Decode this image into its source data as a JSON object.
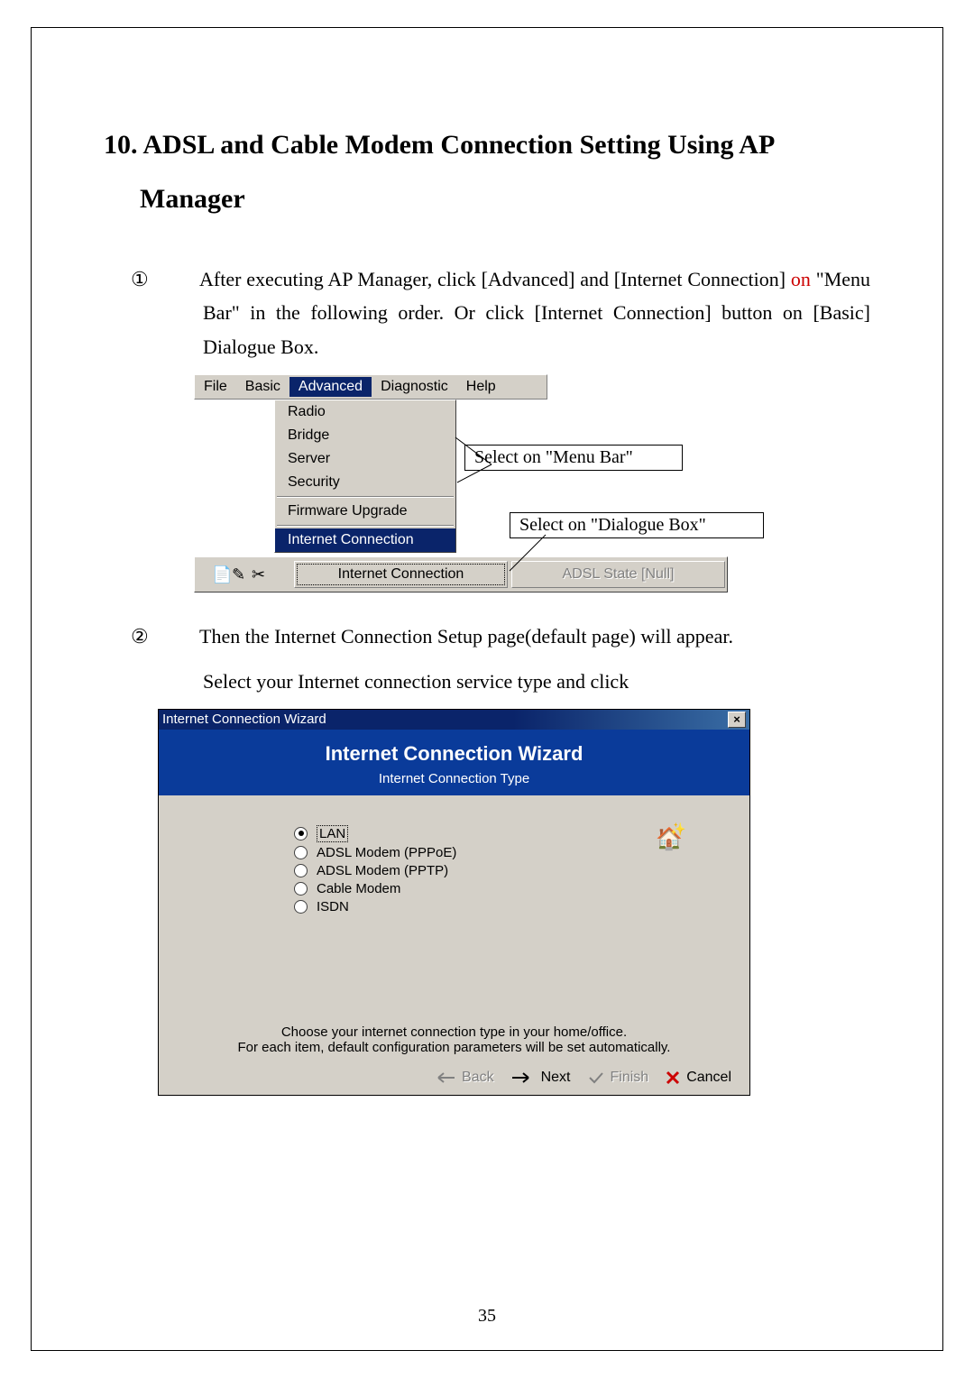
{
  "section": {
    "number": "10.",
    "title": "ADSL and Cable Modem Connection Setting Using AP Manager"
  },
  "step1": {
    "marker": "①",
    "pre": "After executing AP Manager, click [Advanced] and [Internet Connection]",
    "red": " on",
    "post": " \"Menu Bar\" in the following order. Or click [Internet Connection] button on [Basic] Dialogue Box."
  },
  "step2": {
    "marker": "②",
    "line1": "Then the Internet Connection Setup page(default page) will appear.",
    "line2": "Select your Internet connection service type and click"
  },
  "menubar": {
    "items": [
      "File",
      "Basic",
      "Advanced",
      "Diagnostic",
      "Help"
    ],
    "selected": "Advanced"
  },
  "dropdown": {
    "items": [
      "Radio",
      "Bridge",
      "Server",
      "Security"
    ],
    "items2": [
      "Firmware Upgrade"
    ],
    "items3": [
      "Internet Connection"
    ],
    "selected": "Internet Connection"
  },
  "callout_menu": "Select on \"Menu Bar\"",
  "callout_dlg": "Select on \"Dialogue Box\"",
  "toolbar": {
    "btn1": "Internet Connection",
    "btn2": "ADSL State [Null]"
  },
  "wizard": {
    "titlebar": "Internet Connection Wizard",
    "header_main": "Internet Connection Wizard",
    "header_sub": "Internet Connection Type",
    "options": [
      {
        "label": "LAN",
        "checked": true
      },
      {
        "label": "ADSL Modem (PPPoE)",
        "checked": false
      },
      {
        "label": "ADSL Modem (PPTP)",
        "checked": false
      },
      {
        "label": "Cable Modem",
        "checked": false
      },
      {
        "label": "ISDN",
        "checked": false
      }
    ],
    "help1": "Choose your internet connection type in your home/office.",
    "help2": "For each item, default configuration parameters will be set automatically.",
    "buttons": {
      "back": "Back",
      "next": "Next",
      "finish": "Finish",
      "cancel": "Cancel"
    }
  },
  "page_number": "35"
}
